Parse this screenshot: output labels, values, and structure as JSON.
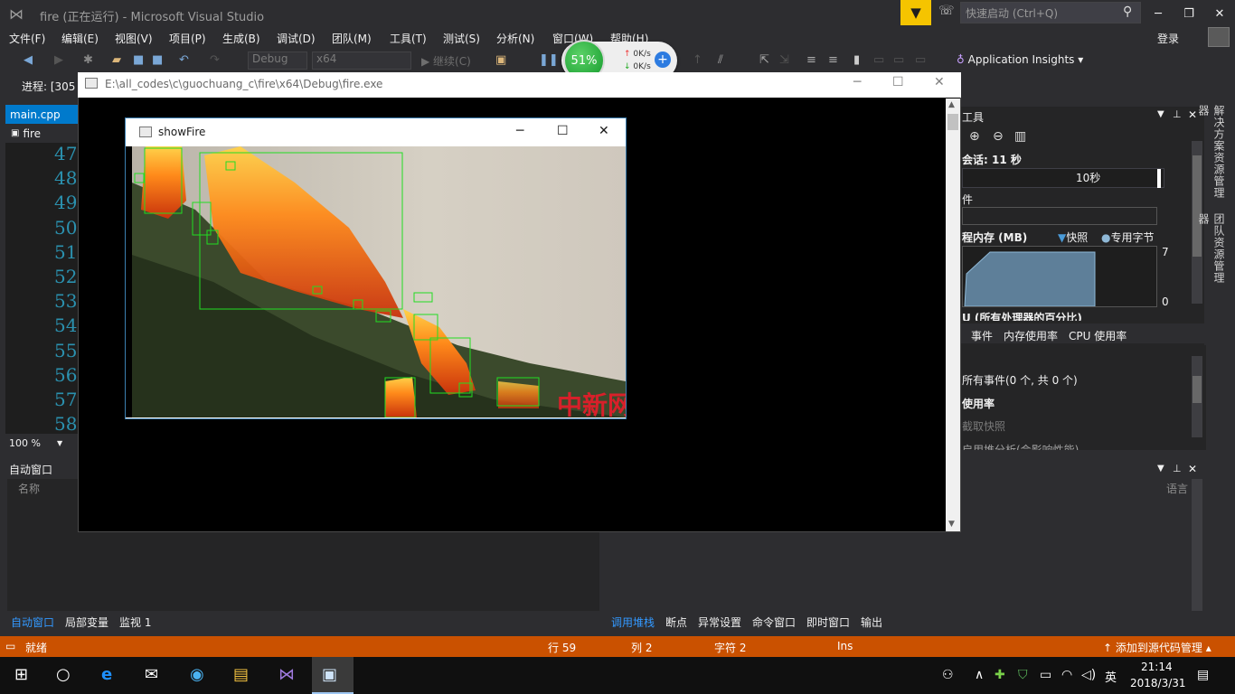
{
  "titlebar": {
    "title": "fire (正在运行) - Microsoft Visual Studio",
    "quick_launch": "快速启动 (Ctrl+Q)"
  },
  "menu": [
    "文件(F)",
    "编辑(E)",
    "视图(V)",
    "项目(P)",
    "生成(B)",
    "调试(D)",
    "团队(M)",
    "工具(T)",
    "测试(S)",
    "分析(N)",
    "窗口(W)",
    "帮助(H)"
  ],
  "login": "登录",
  "toolbar": {
    "config": "Debug",
    "platform": "x64",
    "continue": "继续(C)",
    "app_insights": "Application Insights"
  },
  "speed_widget": {
    "percent": "51%",
    "up": "0K/s",
    "down": "0K/s"
  },
  "process": "进程: [305",
  "editor": {
    "tab": "main.cpp",
    "file": "fire",
    "lines": [
      "47",
      "48",
      "49",
      "50",
      "51",
      "52",
      "53",
      "54",
      "55",
      "56",
      "57",
      "58"
    ],
    "zoom": "100 %"
  },
  "console": {
    "path": "E:\\all_codes\\c\\guochuang_c\\fire\\x64\\Debug\\fire.exe"
  },
  "showfire": {
    "title": "showFire",
    "watermark": "中新网"
  },
  "diagnostics": {
    "title": "工具",
    "session": "会话: 11 秒",
    "tick_label": "10秒",
    "events_label": "件",
    "process_memory": "程内存 (MB)",
    "snapshot_legend": "快照",
    "private_legend": "专用字节",
    "y_max": "7",
    "y_min": "0",
    "cpu_label": "U (所有处理器的百分比)",
    "tabs": [
      "事件",
      "内存使用率",
      "CPU 使用率"
    ],
    "all_events": "所有事件(0 个, 共 0 个)",
    "memory_usage": "使用率",
    "take_snapshot": "截取快照",
    "heap_profiling": "启用堆分析(会影响性能)"
  },
  "side_tabs": [
    "解决方案资源管理器",
    "团队资源管理器"
  ],
  "autos": {
    "title": "自动窗口",
    "name_col": "名称",
    "lang_col": "语言",
    "tabs": [
      "自动窗口",
      "局部变量",
      "监视 1"
    ]
  },
  "callstack_tabs": [
    "调用堆栈",
    "断点",
    "异常设置",
    "命令窗口",
    "即时窗口",
    "输出"
  ],
  "status": {
    "ready": "就绪",
    "line": "行 59",
    "col": "列 2",
    "char": "字符 2",
    "ins": "Ins",
    "source_control": "添加到源代码管理"
  },
  "taskbar": {
    "time": "21:14",
    "date": "2018/3/31",
    "ime": "英"
  },
  "colors": {
    "accent": "#007acc",
    "status_bar": "#ca5100",
    "detect_box": "#22dd22"
  }
}
